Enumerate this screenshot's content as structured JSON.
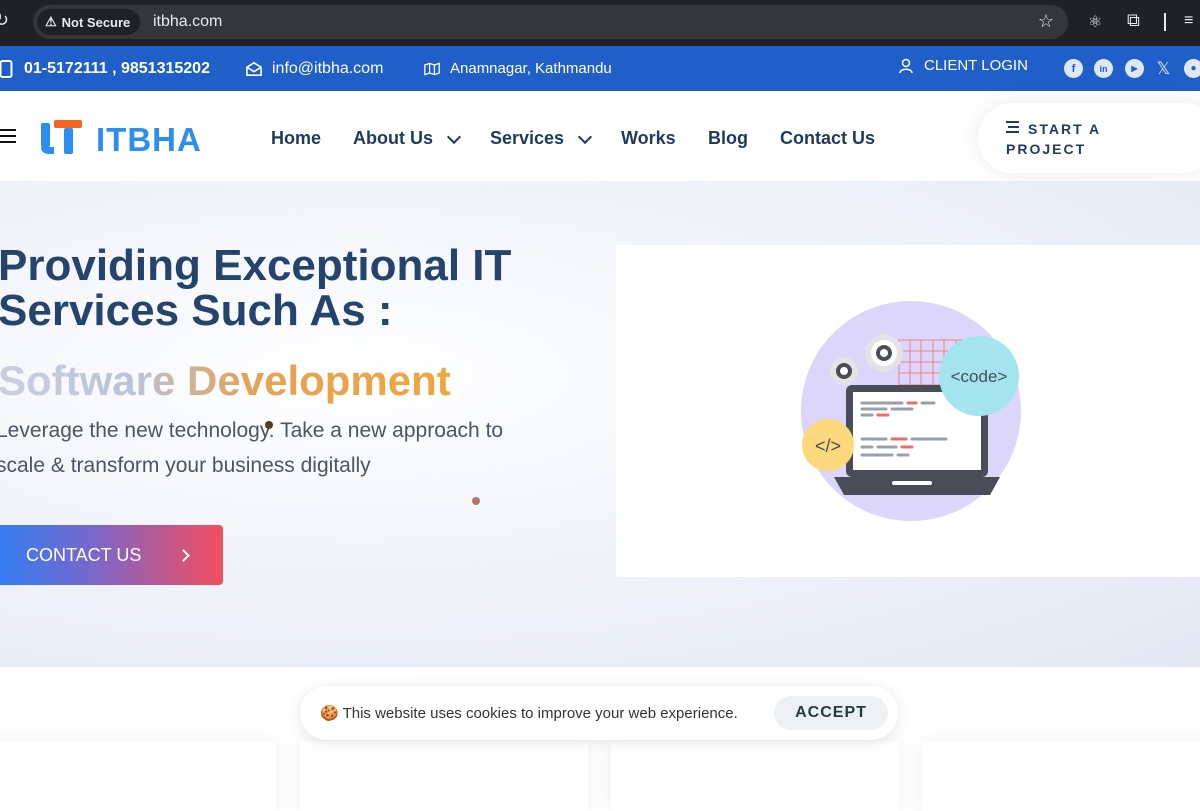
{
  "browser": {
    "security_label": "Not Secure",
    "url": "itbha.com"
  },
  "topbar": {
    "phone": "01-5172111 , 9851315202",
    "email": "info@itbha.com",
    "address": "Anamnagar, Kathmandu",
    "client_login": "CLIENT LOGIN",
    "socials": [
      "facebook-icon",
      "linkedin-icon",
      "youtube-icon",
      "x-icon",
      "github-icon"
    ]
  },
  "nav": {
    "brand": "ITBHA",
    "items": [
      {
        "label": "Home",
        "dropdown": false
      },
      {
        "label": "About Us",
        "dropdown": true
      },
      {
        "label": "Services",
        "dropdown": true
      },
      {
        "label": "Works",
        "dropdown": false
      },
      {
        "label": "Blog",
        "dropdown": false
      },
      {
        "label": "Contact Us",
        "dropdown": false
      }
    ],
    "cta": "START A PROJECT"
  },
  "hero": {
    "headline": "Providing Exceptional IT Services Such As :",
    "typed": "Software Development",
    "lead": "Leverage the new technology. Take a new approach to scale & transform your business digitally",
    "cta": "CONTACT US",
    "illustration": {
      "code_bubble": "<code>",
      "tag_bubble": "</>"
    }
  },
  "cookie": {
    "message": "🍪 This website uses cookies to improve your web experience.",
    "accept": "ACCEPT"
  },
  "colors": {
    "topbar": "#1f5fc7",
    "navy": "#24446e",
    "brand_blue": "#2a8ff0",
    "brand_orange": "#f26522",
    "accent_orange": "#f0a53b"
  }
}
